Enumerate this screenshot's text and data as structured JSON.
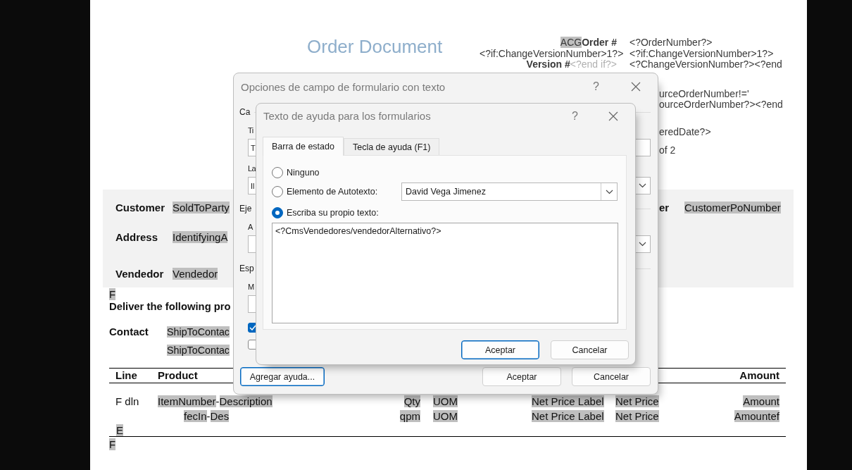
{
  "document": {
    "title": "Order Document",
    "header_rows": [
      {
        "label": [
          {
            "text": "ACG",
            "field": true
          },
          {
            "text": "Order #",
            "kind": "bold"
          }
        ],
        "value": [
          {
            "text": "<?OrderNumber?>"
          }
        ]
      },
      {
        "label": [
          {
            "text": "<?if:ChangeVersionNumber>1?>"
          }
        ],
        "value": [
          {
            "text": "<?if:ChangeVersionNumber>1?>"
          }
        ]
      },
      {
        "label": [
          {
            "text": "Version #",
            "kind": "bold"
          },
          {
            "text": "<?end if?>",
            "kind": "faint"
          }
        ],
        "value": [
          {
            "text": "<?ChangeVersionNumber?><?end"
          }
        ]
      }
    ],
    "header_fragments": [
      "urceOrderNumber!='",
      "ourceOrderNumber?><?end",
      "eredDate?>",
      "of 2"
    ],
    "customer_band": {
      "rows": [
        {
          "label": "Customer",
          "value": {
            "text": "SoldToParty",
            "field": true
          }
        },
        {
          "label": "Address",
          "value": {
            "text": "IdentifyingA",
            "field": true
          }
        },
        {
          "label": "Vendedor",
          "value": {
            "text": "Vendedor",
            "field": true
          }
        }
      ],
      "po_label": "er",
      "po_value": {
        "text": "CustomerPoNumber",
        "field": true
      }
    },
    "marker_top": {
      "text": "F",
      "field": true
    },
    "delivery_heading": "Deliver the following pro",
    "contact": {
      "label": "Contact",
      "values": [
        {
          "text": "ShipToContac",
          "field": true
        },
        {
          "text": "ShipToContac",
          "field": true
        }
      ]
    },
    "table": {
      "columns": {
        "line": "Line",
        "product": "Product",
        "amount": "Amount"
      },
      "rows": [
        {
          "line": [
            {
              "text": "F dln"
            }
          ],
          "indented": false,
          "product": [
            {
              "text": "ItemNumber",
              "field": true
            },
            {
              "text": "-"
            },
            {
              "text": "Description",
              "field": true
            }
          ],
          "qty": [
            {
              "text": "Qty",
              "field": true
            }
          ],
          "uom": [
            {
              "text": "UOM",
              "field": true
            }
          ],
          "price_label": [
            {
              "text": "Net Price Label",
              "field": true
            }
          ],
          "price": [
            {
              "text": "Net Price",
              "field": true
            }
          ],
          "amount": [
            {
              "text": "Amount",
              "field": true
            }
          ]
        },
        {
          "indented": true,
          "product": [
            {
              "text": "fecIn",
              "field": true
            },
            {
              "text": "-"
            },
            {
              "text": "Des",
              "field": true
            }
          ],
          "qty": [
            {
              "text": "qpm",
              "field": true
            }
          ],
          "uom": [
            {
              "text": "UOM",
              "field": true
            }
          ],
          "price_label": [
            {
              "text": "Net Price Label",
              "field": true
            }
          ],
          "price": [
            {
              "text": "Net Price",
              "field": true
            }
          ],
          "amount": [
            {
              "text": "Amountef",
              "field": true
            }
          ]
        }
      ],
      "end_marker": {
        "text": "E",
        "field": true
      }
    },
    "marker_bottom": {
      "text": "F",
      "field": true
    }
  },
  "form_dialog": {
    "title": "Opciones de campo de formulario con texto",
    "help": "?",
    "sections": [
      {
        "heading": "Ca",
        "rows": [
          {
            "label": "Ti",
            "left": {
              "kind": "field",
              "value": "T"
            },
            "right": {
              "kind": "field"
            }
          },
          {
            "label": "La",
            "left": {
              "kind": "field",
              "value": "Il"
            },
            "right": {
              "kind": "dropdown"
            }
          }
        ]
      },
      {
        "heading": "Eje",
        "rows": [
          {
            "label": "A",
            "left": {
              "kind": "field"
            },
            "right": {
              "kind": "dropdown"
            }
          }
        ]
      },
      {
        "heading": "Esp",
        "rows": [
          {
            "label": "M",
            "left": {
              "kind": "field"
            }
          }
        ]
      }
    ],
    "checkboxes": [
      {
        "checked": true
      },
      {
        "checked": false
      }
    ],
    "buttons": [
      {
        "label": "Agregar ayuda...",
        "default": true
      },
      {
        "label": "Aceptar",
        "default": false
      },
      {
        "label": "Cancelar",
        "default": false
      }
    ]
  },
  "help_dialog": {
    "title": "Texto de ayuda para los formularios",
    "help": "?",
    "tabs": [
      {
        "label": "Barra de estado",
        "selected": true
      },
      {
        "label": "Tecla de ayuda (F1)",
        "selected": false
      }
    ],
    "options": [
      {
        "label": "Ninguno",
        "selected": false,
        "kind": "plain"
      },
      {
        "label": "Elemento de Autotexto:",
        "selected": false,
        "kind": "dropdown",
        "value": "David Vega Jimenez"
      },
      {
        "label": "Escriba su propio texto:",
        "selected": true,
        "kind": "text",
        "value": "<?CmsVendedores/vendedorAlternativo?>"
      }
    ],
    "buttons": [
      {
        "label": "Aceptar",
        "default": true
      },
      {
        "label": "Cancelar",
        "default": false
      }
    ]
  }
}
